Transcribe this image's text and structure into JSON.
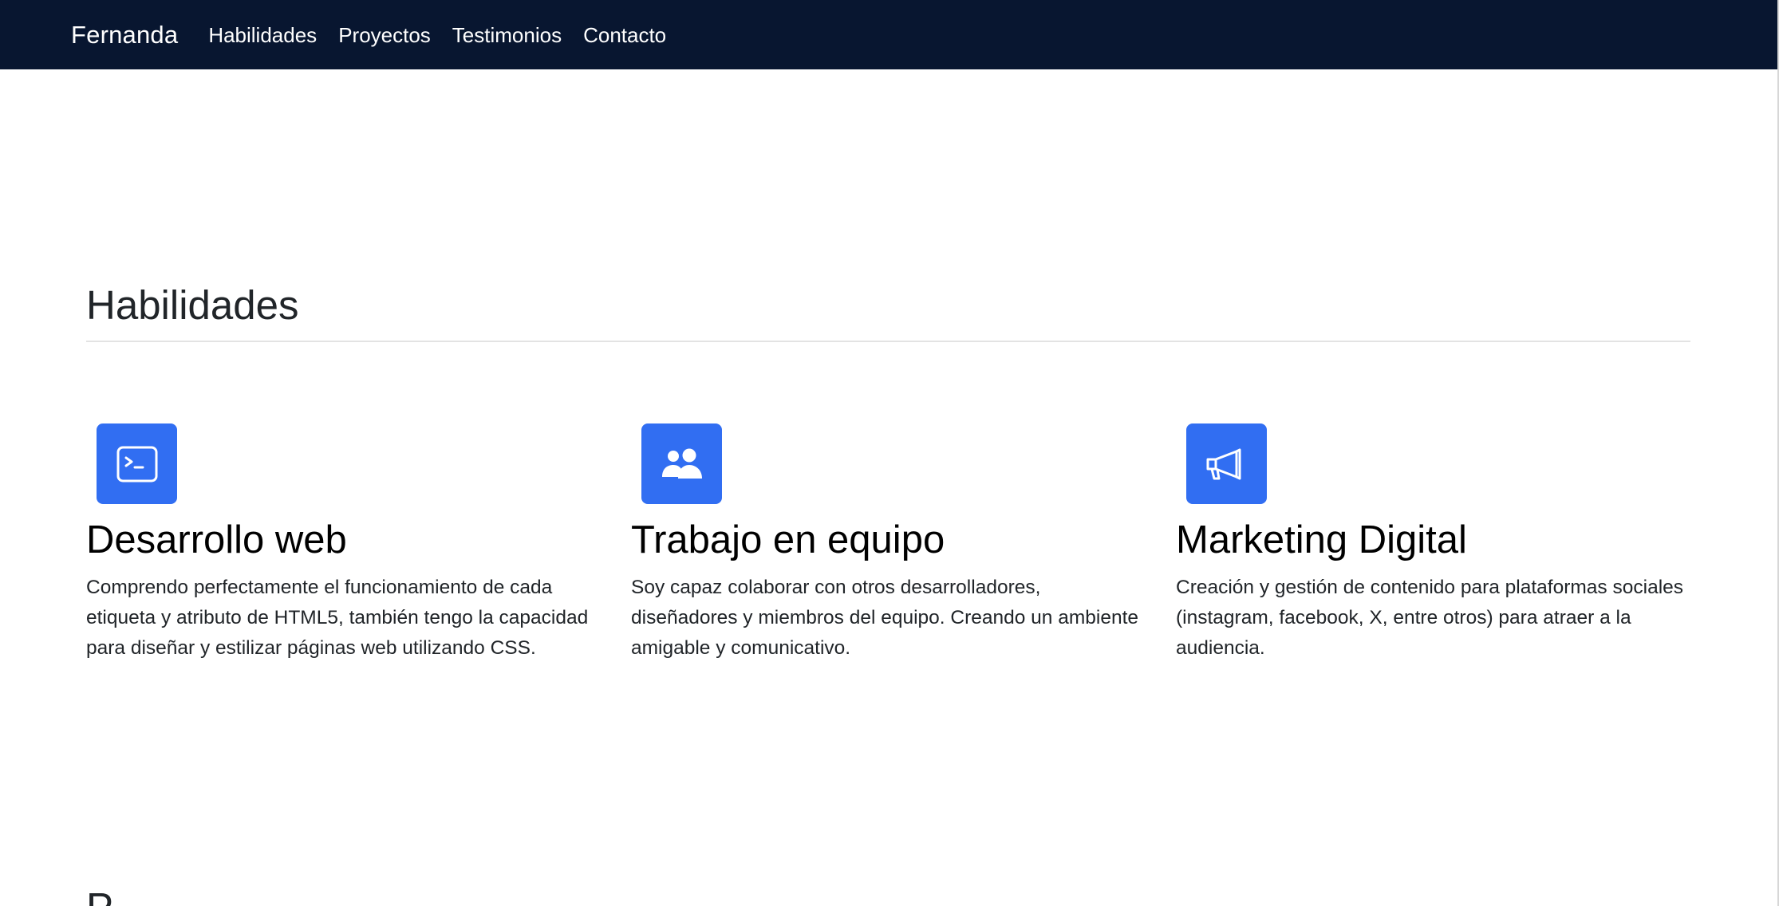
{
  "nav": {
    "brand": "Fernanda",
    "links": [
      "Habilidades",
      "Proyectos",
      "Testimonios",
      "Contacto"
    ],
    "background_color": "#081630"
  },
  "skills_section": {
    "title": "Habilidades",
    "icon_color": "#316ef2",
    "items": [
      {
        "icon": "terminal-icon",
        "title": "Desarrollo web",
        "description": "Comprendo perfectamente el funcionamiento de cada etiqueta y atributo de HTML5, también tengo la capacidad para diseñar y estilizar páginas web utilizando CSS."
      },
      {
        "icon": "people-icon",
        "title": "Trabajo en equipo",
        "description": "Soy capaz colaborar con otros desarrolladores, diseñadores y miembros del equipo. Creando un ambiente amigable y comunicativo."
      },
      {
        "icon": "megaphone-icon",
        "title": "Marketing Digital",
        "description": "Creación y gestión de contenido para plataformas sociales (instagram, facebook, X, entre otros) para atraer a la audiencia."
      }
    ]
  },
  "next_section": {
    "title_peek": "P"
  }
}
